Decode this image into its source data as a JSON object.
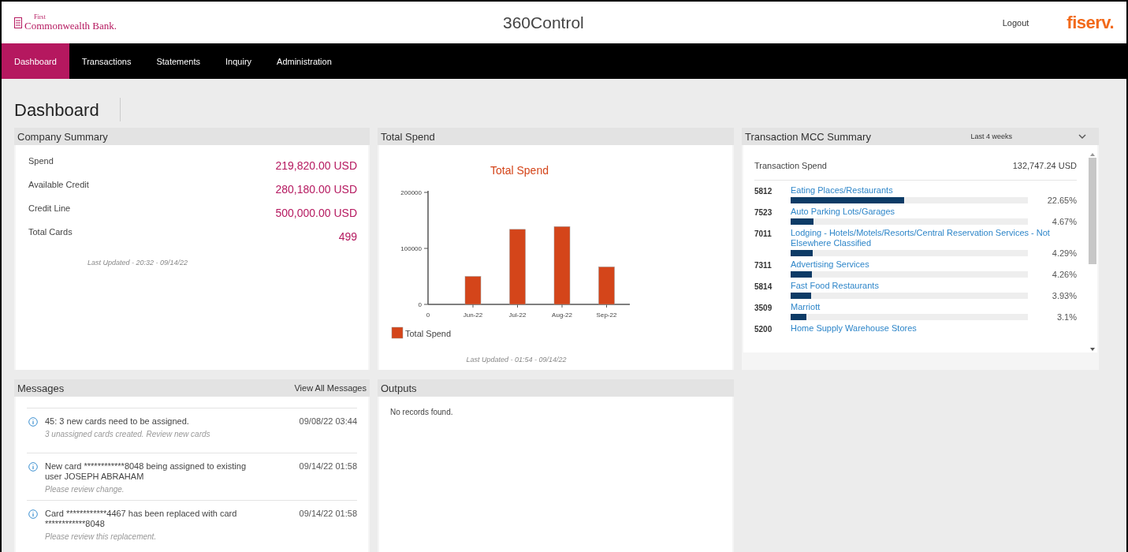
{
  "header": {
    "logo_small": "First",
    "logo_main": "Commonwealth Bank.",
    "title": "360Control",
    "logout": "Logout",
    "brand": "fiserv."
  },
  "nav": [
    {
      "label": "Dashboard",
      "selected": true
    },
    {
      "label": "Transactions",
      "selected": false
    },
    {
      "label": "Statements",
      "selected": false
    },
    {
      "label": "Inquiry",
      "selected": false
    },
    {
      "label": "Administration",
      "selected": false
    }
  ],
  "page_title": "Dashboard",
  "company_summary": {
    "title": "Company Summary",
    "rows": [
      {
        "label": "Spend",
        "value": "219,820.00 USD"
      },
      {
        "label": "Available Credit",
        "value": "280,180.00 USD"
      },
      {
        "label": "Credit Line",
        "value": "500,000.00 USD"
      },
      {
        "label": "Total Cards",
        "value": "499"
      }
    ],
    "updated": "Last Updated - 20:32 - 09/14/22"
  },
  "total_spend": {
    "title": "Total Spend",
    "updated": "Last Updated - 01:54 - 09/14/22",
    "x_origin_label": "0",
    "chart_data": {
      "type": "bar",
      "title": "Total Spend",
      "categories": [
        "Jun-22",
        "Jul-22",
        "Aug-22",
        "Sep-22"
      ],
      "series": [
        {
          "name": "Total Spend",
          "color": "#d4451a",
          "values": [
            50000,
            134000,
            139000,
            67000
          ]
        }
      ],
      "ylim": [
        0,
        200000
      ],
      "yticks": [
        0,
        100000,
        200000
      ]
    }
  },
  "mcc_summary": {
    "title": "Transaction MCC Summary",
    "period": "Last 4 weeks",
    "total_label": "Transaction Spend",
    "total_value": "132,747.24 USD",
    "items": [
      {
        "code": "5812",
        "name": "Eating Places/Restaurants",
        "level": 0.48,
        "percent": "22.65%"
      },
      {
        "code": "7523",
        "name": "Auto Parking Lots/Garages",
        "level": 0.097,
        "percent": "4.67%"
      },
      {
        "code": "7011",
        "name": "Lodging - Hotels/Motels/Resorts/Central Reservation Services - Not Elsewhere Classified",
        "level": 0.092,
        "percent": "4.29%"
      },
      {
        "code": "7311",
        "name": "Advertising Services",
        "level": 0.09,
        "percent": "4.26%"
      },
      {
        "code": "5814",
        "name": "Fast Food Restaurants",
        "level": 0.085,
        "percent": "3.93%"
      },
      {
        "code": "3509",
        "name": "Marriott",
        "level": 0.068,
        "percent": "3.1%"
      },
      {
        "code": "5200",
        "name": "Home Supply Warehouse Stores"
      }
    ]
  },
  "messages": {
    "title": "Messages",
    "view_all": "View All Messages",
    "items": [
      {
        "text": "45: 3 new cards need to be assigned.",
        "date": "09/08/22 03:44",
        "detail": "3 unassigned cards created. Review new cards"
      },
      {
        "text": "New card ************8048 being assigned to existing user JOSEPH ABRAHAM",
        "date": "09/14/22 01:58",
        "detail": "Please review change."
      },
      {
        "text": "Card ************4467 has been replaced with card ************8048",
        "date": "09/14/22 01:58",
        "detail": "Please review this replacement."
      }
    ]
  },
  "outputs": {
    "title": "Outputs",
    "empty": "No records found."
  }
}
